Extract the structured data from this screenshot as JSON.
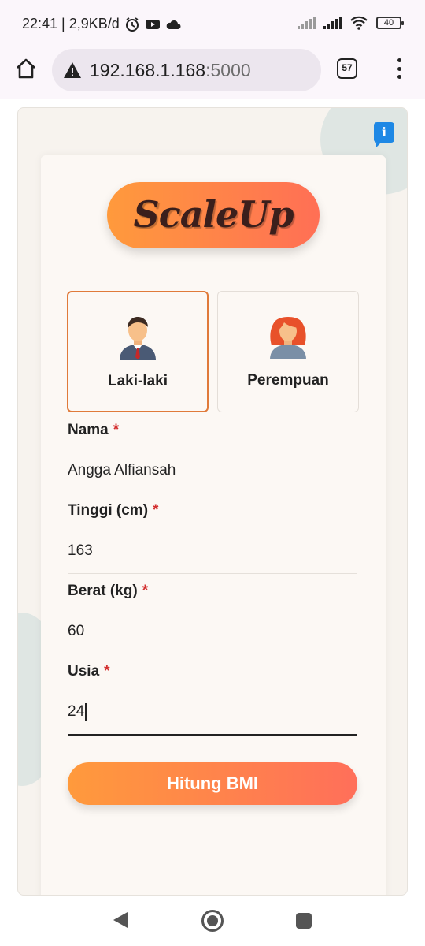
{
  "status_bar": {
    "time_info": "22:41 | 2,9KB/d",
    "battery": "40"
  },
  "browser": {
    "url_host": "192.168.1.168",
    "url_port": ":5000",
    "tab_count": "57"
  },
  "app": {
    "logo": "ScaleUp",
    "info_icon": "i"
  },
  "gender": {
    "selected": "male",
    "options": [
      {
        "label": "Laki-laki",
        "icon": "male-avatar-icon"
      },
      {
        "label": "Perempuan",
        "icon": "female-avatar-icon"
      }
    ]
  },
  "form": {
    "required_mark": "*",
    "fields": [
      {
        "label": "Nama",
        "value": "Angga Alfiansah"
      },
      {
        "label": "Tinggi (cm)",
        "value": "163"
      },
      {
        "label": "Berat (kg)",
        "value": "60"
      },
      {
        "label": "Usia",
        "value": "24"
      }
    ],
    "submit_label": "Hitung BMI"
  },
  "colors": {
    "accent_start": "#ff9a3c",
    "accent_end": "#ff6f55",
    "selected_border": "#e07a3a",
    "info_blue": "#1e88e5",
    "required_red": "#d32f2f"
  }
}
